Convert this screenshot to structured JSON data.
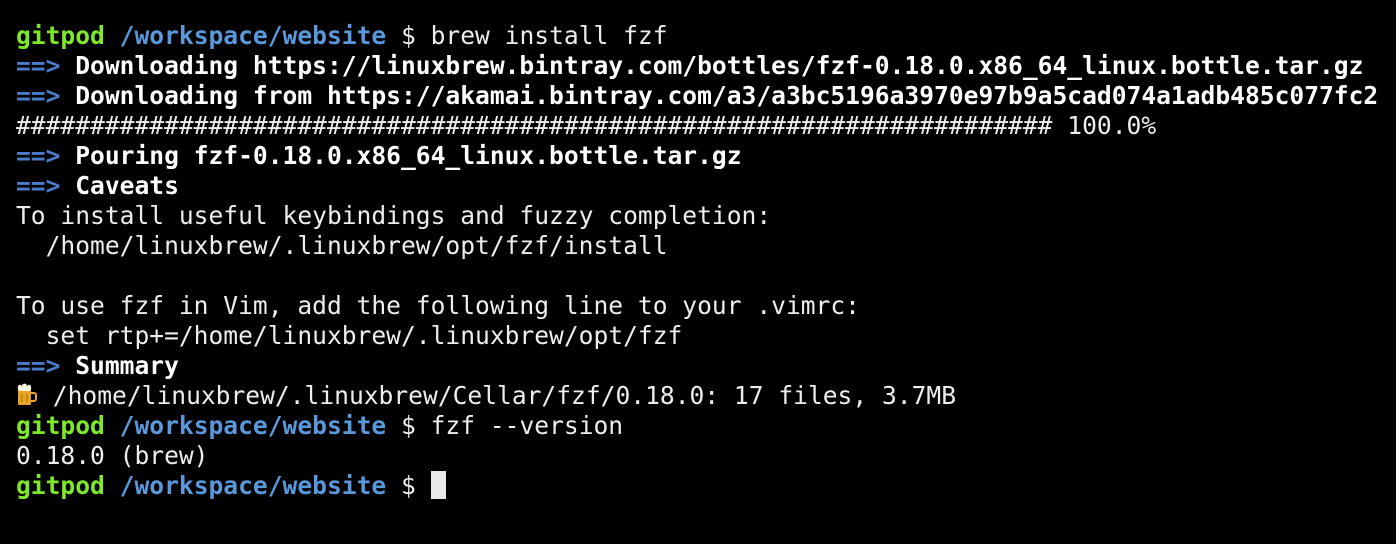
{
  "prompt": {
    "user": "gitpod",
    "path": "/workspace/website",
    "symbol": "$"
  },
  "arrow": "==>",
  "commands": {
    "install": "brew install fzf",
    "version": "fzf --version"
  },
  "output": {
    "download1": "Downloading https://linuxbrew.bintray.com/bottles/fzf-0.18.0.x86_64_linux.bottle.tar.gz",
    "download2": "Downloading from https://akamai.bintray.com/a3/a3bc5196a3970e97b9a5cad074a1adb485c077fc2",
    "progress_bar": "######################################################################",
    "progress_pct": "100.0%",
    "pouring": "Pouring fzf-0.18.0.x86_64_linux.bottle.tar.gz",
    "caveats": "Caveats",
    "caveat1": "To install useful keybindings and fuzzy completion:",
    "caveat1_path": "  /home/linuxbrew/.linuxbrew/opt/fzf/install",
    "caveat2": "To use fzf in Vim, add the following line to your .vimrc:",
    "caveat2_cmd": "  set rtp+=/home/linuxbrew/.linuxbrew/opt/fzf",
    "summary": "Summary",
    "summary_detail": " /home/linuxbrew/.linuxbrew/Cellar/fzf/0.18.0: 17 files, 3.7MB",
    "version": "0.18.0 (brew)"
  },
  "icons": {
    "summary_icon": "beer-mug-icon"
  },
  "colors": {
    "background": "#000000",
    "user": "#7ee82a",
    "path": "#5a98dc",
    "arrow": "#4a7cc9",
    "text": "#ededed"
  }
}
